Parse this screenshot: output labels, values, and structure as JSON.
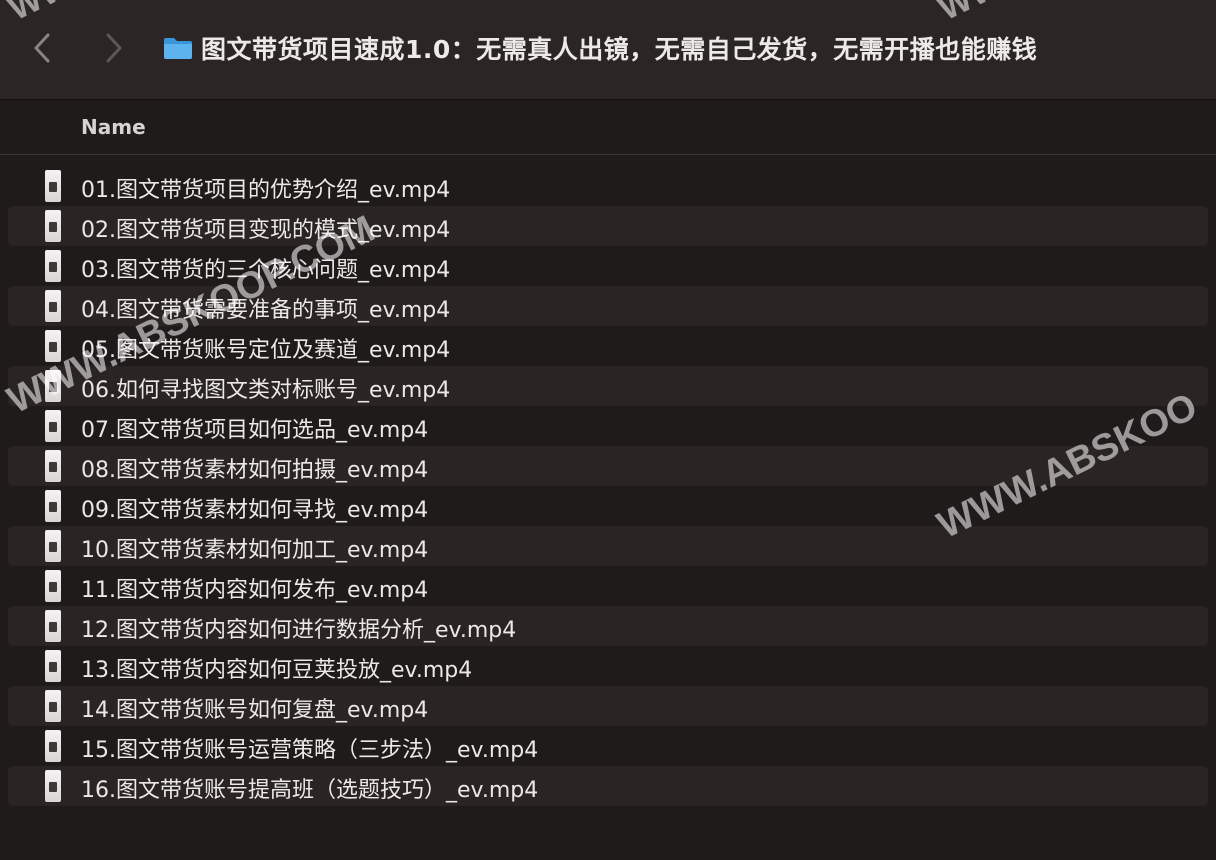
{
  "window": {
    "title": "图文带货项目速成1.0：无需真人出镜，无需自己发货，无需开播也能赚钱"
  },
  "toolbar": {
    "back_icon": "chevron-left-icon",
    "forward_icon": "chevron-right-icon",
    "folder_icon": "folder-icon",
    "folder_color": "#4aa8e8"
  },
  "columns": {
    "name": "Name"
  },
  "files": [
    {
      "name": "01.图文带货项目的优势介绍_ev.mp4"
    },
    {
      "name": "02.图文带货项目变现的模式_ev.mp4"
    },
    {
      "name": "03.图文带货的三个核心问题_ev.mp4"
    },
    {
      "name": "04.图文带货需要准备的事项_ev.mp4"
    },
    {
      "name": "05.图文带货账号定位及赛道_ev.mp4"
    },
    {
      "name": "06.如何寻找图文类对标账号_ev.mp4"
    },
    {
      "name": "07.图文带货项目如何选品_ev.mp4"
    },
    {
      "name": "08.图文带货素材如何拍摄_ev.mp4"
    },
    {
      "name": "09.图文带货素材如何寻找_ev.mp4"
    },
    {
      "name": "10.图文带货素材如何加工_ev.mp4"
    },
    {
      "name": "11.图文带货内容如何发布_ev.mp4"
    },
    {
      "name": "12.图文带货内容如何进行数据分析_ev.mp4"
    },
    {
      "name": "13.图文带货内容如何豆荚投放_ev.mp4"
    },
    {
      "name": "14.图文带货账号如何复盘_ev.mp4"
    },
    {
      "name": "15.图文带货账号运营策略（三步法）_ev.mp4"
    },
    {
      "name": "16.图文带货账号提高班（选题技巧）_ev.mp4"
    }
  ],
  "watermark": {
    "main": "WWW.ABSKOOP.COM",
    "partial": "WWW.ABSKOO",
    "top": "WWW"
  }
}
